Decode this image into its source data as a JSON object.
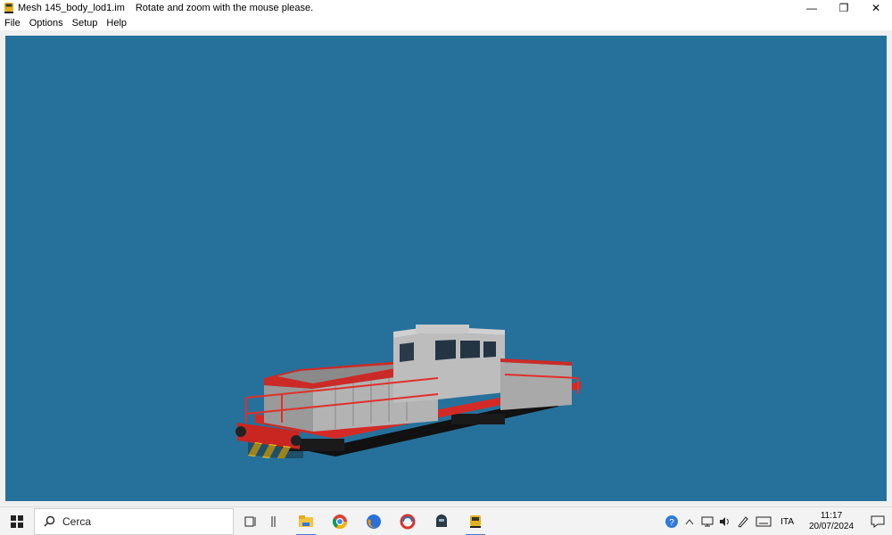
{
  "window": {
    "title": "Mesh 145_body_lod1.im",
    "hint": "Rotate and zoom with the mouse please.",
    "controls": {
      "minimize": "—",
      "restore": "❐",
      "close": "✕"
    }
  },
  "menu": [
    "File",
    "Options",
    "Setup",
    "Help"
  ],
  "viewport": {
    "background": "#26719b"
  },
  "taskbar": {
    "search_placeholder": "Cerca",
    "apps": [
      "task-view",
      "widgets",
      "file-explorer",
      "chrome",
      "firefox",
      "ccleaner",
      "app-dark",
      "train-app"
    ],
    "tray": {
      "language": "ITA",
      "time": "11:17",
      "date": "20/07/2024"
    }
  }
}
